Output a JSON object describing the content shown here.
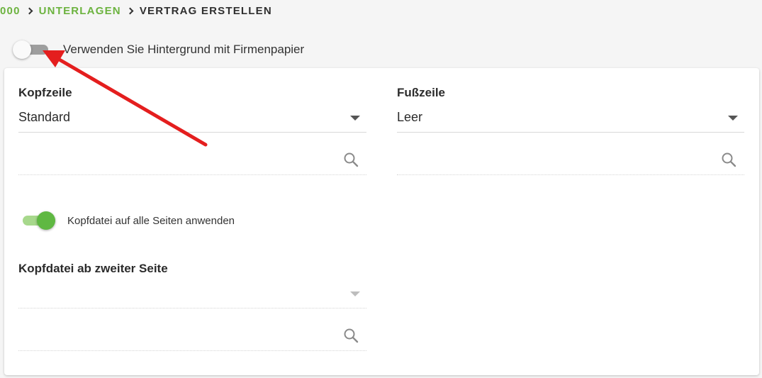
{
  "breadcrumb": {
    "items": [
      {
        "label": "000"
      },
      {
        "label": "UNTERLAGEN"
      },
      {
        "label": "VERTRAG ERSTELLEN"
      }
    ]
  },
  "background_toggle": {
    "label": "Verwenden Sie Hintergrund mit Firmenpapier",
    "checked": false
  },
  "header_section": {
    "title": "Kopfzeile",
    "selected": "Standard",
    "search_value": ""
  },
  "footer_section": {
    "title": "Fußzeile",
    "selected": "Leer",
    "search_value": ""
  },
  "apply_all_toggle": {
    "label": "Kopfdatei auf alle Seiten anwenden",
    "checked": true
  },
  "second_page_header": {
    "title": "Kopfdatei ab zweiter Seite",
    "selected": "",
    "search_value": ""
  },
  "icons": {
    "search": "search-icon",
    "dropdown": "caret-down-icon",
    "breadcrumb_separator": "chevron-right-icon",
    "annotation": "red-arrow-icon"
  },
  "colors": {
    "accent_green": "#6cb33f",
    "toggle_on_thumb": "#5fb842",
    "toggle_on_track": "#a7d88c",
    "toggle_off_track": "#9e9e9e",
    "annotation_red": "#e41e1e"
  }
}
